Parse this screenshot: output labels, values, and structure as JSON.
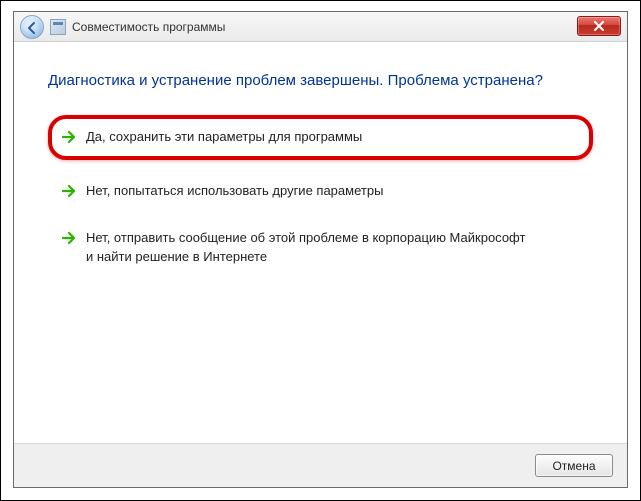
{
  "titlebar": {
    "title": "Совместимость программы"
  },
  "heading": "Диагностика и устранение проблем завершены. Проблема устранена?",
  "options": [
    {
      "label": "Да, сохранить эти параметры для программы"
    },
    {
      "label": "Нет, попытаться использовать другие параметры"
    },
    {
      "label": "Нет, отправить сообщение об этой проблеме в корпорацию Майкрософт и найти решение в Интернете"
    }
  ],
  "footer": {
    "cancel": "Отмена"
  },
  "colors": {
    "heading": "#003399",
    "highlight_border": "#d80000",
    "arrow": "#2bb300"
  }
}
